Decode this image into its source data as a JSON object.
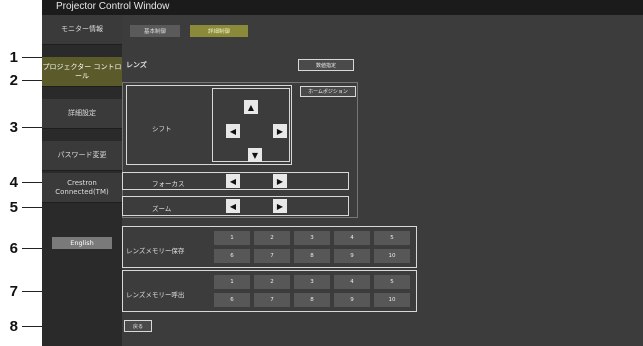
{
  "callouts": [
    "1",
    "2",
    "3",
    "4",
    "5",
    "6",
    "7",
    "8"
  ],
  "window": {
    "title": "Projector Control Window"
  },
  "sidebar": {
    "items": [
      {
        "label": "モニター情報"
      },
      {
        "label": "プロジェクター コントロール"
      },
      {
        "label": "詳細設定"
      },
      {
        "label": "パスワード変更"
      },
      {
        "label": "Crestron Connected(TM)"
      }
    ],
    "english": "English"
  },
  "tabs": {
    "basic": "基本制御",
    "detail": "詳細制御"
  },
  "lens": {
    "title": "レンズ",
    "numeric_button": "数値指定",
    "home_button": "ホームポジション",
    "shift_label": "シフト",
    "focus_label": "フォーカス",
    "zoom_label": "ズーム"
  },
  "memory_save": {
    "label": "レンズメモリー保存",
    "row1": [
      "1",
      "2",
      "3",
      "4",
      "5"
    ],
    "row2": [
      "6",
      "7",
      "8",
      "9",
      "10"
    ]
  },
  "memory_load": {
    "label": "レンズメモリー呼出",
    "row1": [
      "1",
      "2",
      "3",
      "4",
      "5"
    ],
    "row2": [
      "6",
      "7",
      "8",
      "9",
      "10"
    ]
  },
  "back_button": "戻る",
  "icons": {
    "up": "arrow-up-icon",
    "down": "arrow-down-icon",
    "left": "arrow-left-icon",
    "right": "arrow-right-icon"
  }
}
